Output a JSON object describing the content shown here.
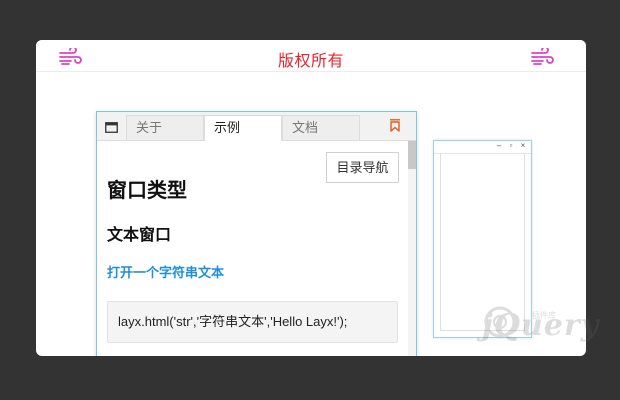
{
  "header": {
    "title": "版权所有",
    "left_icon": "wind-icon",
    "right_icon": "wind-icon",
    "accent_color": "#e3262e",
    "icon_color": "#e040c8"
  },
  "background_window": {
    "controls": [
      "–",
      "▫",
      "×"
    ]
  },
  "window": {
    "icon": "window-icon",
    "tabs": [
      {
        "label": "关于",
        "active": false
      },
      {
        "label": "示例",
        "active": true
      },
      {
        "label": "文档",
        "active": false
      }
    ],
    "sticky_icon": "bookmark-icon",
    "toc_button": "目录导航",
    "content": {
      "heading": "窗口类型",
      "subheading": "文本窗口",
      "link": "打开一个字符串文本",
      "code": "layx.html('str','字符串文本','Hello Layx!');"
    },
    "border_color": "#7fc3e6",
    "link_color": "#1e8fd8"
  },
  "watermark": {
    "logo": "jQuery",
    "tagline": "插件库"
  }
}
